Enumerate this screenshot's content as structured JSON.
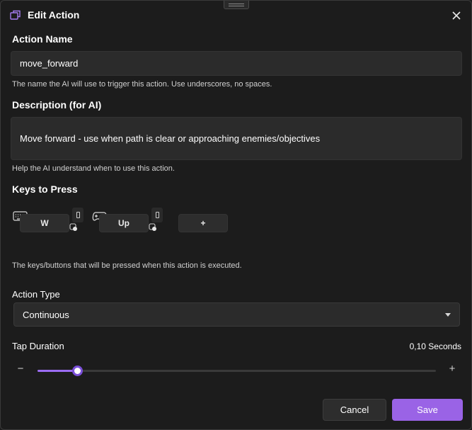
{
  "dialog": {
    "title": "Edit Action",
    "icons": {
      "title": "window-stack-icon",
      "close": "close-icon"
    }
  },
  "action_name": {
    "label": "Action Name",
    "value": "move_forward",
    "hint": "The name the AI will use to trigger this action. Use underscores, no spaces."
  },
  "description": {
    "label": "Description (for AI)",
    "value": "Move forward - use when path is clear or approaching enemies/objectives",
    "hint": "Help the AI understand when to use this action."
  },
  "keys": {
    "label": "Keys to Press",
    "items": [
      {
        "device": "keyboard-icon",
        "key": "W"
      },
      {
        "device": "gamepad-icon",
        "key": "Up"
      }
    ],
    "add_label": "+",
    "hint": "The keys/buttons that will be pressed when this action is executed."
  },
  "action_type": {
    "label": "Action Type",
    "selected": "Continuous"
  },
  "tap_duration": {
    "label": "Tap Duration",
    "value_text": "0,10 Seconds",
    "minus": "−",
    "plus": "+",
    "level": 0.1
  },
  "buttons": {
    "cancel": "Cancel",
    "save": "Save"
  },
  "colors": {
    "accent": "#9a63e6",
    "background": "#1c1c1c",
    "field": "#2b2b2b"
  }
}
